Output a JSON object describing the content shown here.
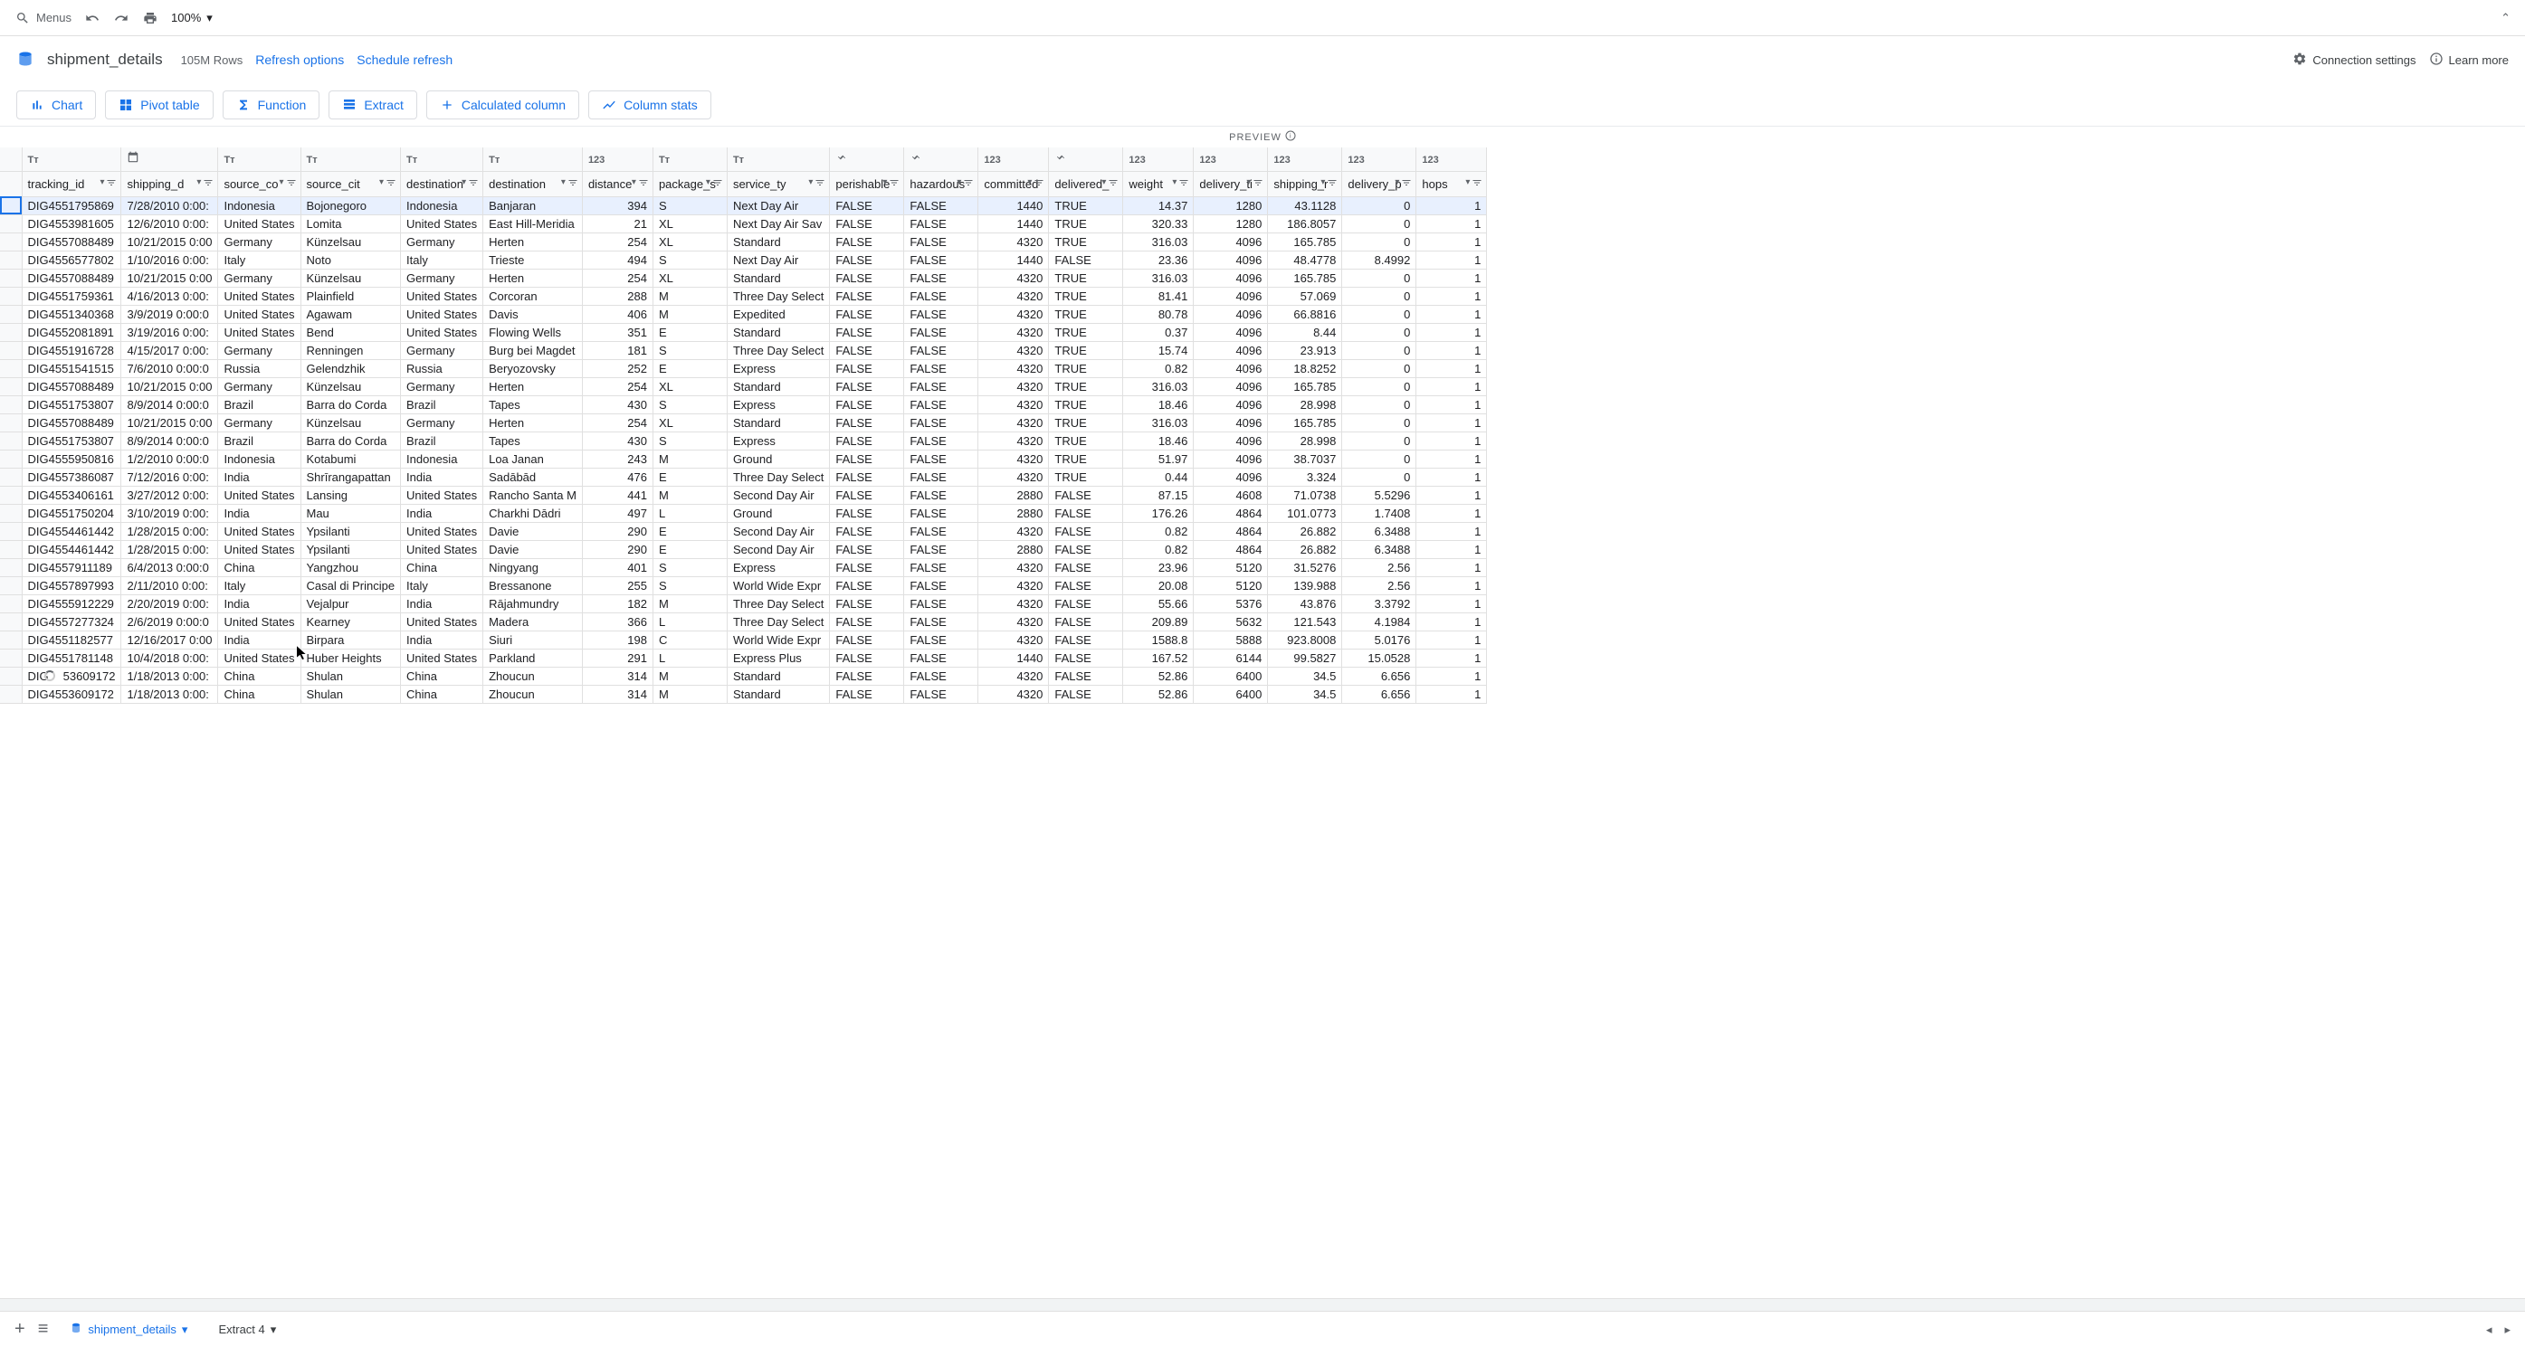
{
  "toolbar": {
    "menus": "Menus",
    "zoom": "100%"
  },
  "header": {
    "table_name": "shipment_details",
    "row_count": "105M Rows",
    "refresh_options": "Refresh options",
    "schedule_refresh": "Schedule refresh",
    "connection_settings": "Connection settings",
    "learn_more": "Learn more"
  },
  "actions": {
    "chart": "Chart",
    "pivot": "Pivot table",
    "function": "Function",
    "extract": "Extract",
    "calc_col": "Calculated column",
    "col_stats": "Column stats"
  },
  "preview": "PREVIEW",
  "columns": [
    {
      "name": "tracking_id",
      "type": "Tт",
      "align": "left",
      "width": 84
    },
    {
      "name": "shipping_d",
      "type": "date",
      "align": "left",
      "width": 80
    },
    {
      "name": "source_co",
      "type": "Tт",
      "align": "left",
      "width": 82
    },
    {
      "name": "source_cit",
      "type": "Tт",
      "align": "left",
      "width": 82
    },
    {
      "name": "destination",
      "type": "Tт",
      "align": "left",
      "width": 82
    },
    {
      "name": "destination",
      "type": "Tт",
      "align": "left",
      "width": 82
    },
    {
      "name": "distance",
      "type": "123",
      "align": "right",
      "width": 78
    },
    {
      "name": "package_s",
      "type": "Tт",
      "align": "left",
      "width": 82
    },
    {
      "name": "service_ty",
      "type": "Tт",
      "align": "left",
      "width": 82
    },
    {
      "name": "perishable",
      "type": "bool",
      "align": "left",
      "width": 82
    },
    {
      "name": "hazardous",
      "type": "bool",
      "align": "left",
      "width": 82
    },
    {
      "name": "committed",
      "type": "123",
      "align": "right",
      "width": 78
    },
    {
      "name": "delivered_",
      "type": "bool",
      "align": "left",
      "width": 82
    },
    {
      "name": "weight",
      "type": "123",
      "align": "right",
      "width": 78
    },
    {
      "name": "delivery_ti",
      "type": "123",
      "align": "right",
      "width": 82
    },
    {
      "name": "shipping_r",
      "type": "123",
      "align": "right",
      "width": 82
    },
    {
      "name": "delivery_p",
      "type": "123",
      "align": "right",
      "width": 82
    },
    {
      "name": "hops",
      "type": "123",
      "align": "right",
      "width": 78
    }
  ],
  "rows": [
    [
      "DIG4551795869",
      "7/28/2010 0:00:",
      "Indonesia",
      "Bojonegoro",
      "Indonesia",
      "Banjaran",
      "394",
      "S",
      "Next Day Air",
      "FALSE",
      "FALSE",
      "1440",
      "TRUE",
      "14.37",
      "1280",
      "43.1128",
      "0",
      "1"
    ],
    [
      "DIG4553981605",
      "12/6/2010 0:00:",
      "United States",
      "Lomita",
      "United States",
      "East Hill-Meridia",
      "21",
      "XL",
      "Next Day Air Sav",
      "FALSE",
      "FALSE",
      "1440",
      "TRUE",
      "320.33",
      "1280",
      "186.8057",
      "0",
      "1"
    ],
    [
      "DIG4557088489",
      "10/21/2015 0:00",
      "Germany",
      "Künzelsau",
      "Germany",
      "Herten",
      "254",
      "XL",
      "Standard",
      "FALSE",
      "FALSE",
      "4320",
      "TRUE",
      "316.03",
      "4096",
      "165.785",
      "0",
      "1"
    ],
    [
      "DIG4556577802",
      "1/10/2016 0:00:",
      "Italy",
      "Noto",
      "Italy",
      "Trieste",
      "494",
      "S",
      "Next Day Air",
      "FALSE",
      "FALSE",
      "1440",
      "FALSE",
      "23.36",
      "4096",
      "48.4778",
      "8.4992",
      "1"
    ],
    [
      "DIG4557088489",
      "10/21/2015 0:00",
      "Germany",
      "Künzelsau",
      "Germany",
      "Herten",
      "254",
      "XL",
      "Standard",
      "FALSE",
      "FALSE",
      "4320",
      "TRUE",
      "316.03",
      "4096",
      "165.785",
      "0",
      "1"
    ],
    [
      "DIG4551759361",
      "4/16/2013 0:00:",
      "United States",
      "Plainfield",
      "United States",
      "Corcoran",
      "288",
      "M",
      "Three Day Select",
      "FALSE",
      "FALSE",
      "4320",
      "TRUE",
      "81.41",
      "4096",
      "57.069",
      "0",
      "1"
    ],
    [
      "DIG4551340368",
      "3/9/2019 0:00:0",
      "United States",
      "Agawam",
      "United States",
      "Davis",
      "406",
      "M",
      "Expedited",
      "FALSE",
      "FALSE",
      "4320",
      "TRUE",
      "80.78",
      "4096",
      "66.8816",
      "0",
      "1"
    ],
    [
      "DIG4552081891",
      "3/19/2016 0:00:",
      "United States",
      "Bend",
      "United States",
      "Flowing Wells",
      "351",
      "E",
      "Standard",
      "FALSE",
      "FALSE",
      "4320",
      "TRUE",
      "0.37",
      "4096",
      "8.44",
      "0",
      "1"
    ],
    [
      "DIG4551916728",
      "4/15/2017 0:00:",
      "Germany",
      "Renningen",
      "Germany",
      "Burg bei Magdet",
      "181",
      "S",
      "Three Day Select",
      "FALSE",
      "FALSE",
      "4320",
      "TRUE",
      "15.74",
      "4096",
      "23.913",
      "0",
      "1"
    ],
    [
      "DIG4551541515",
      "7/6/2010 0:00:0",
      "Russia",
      "Gelendzhik",
      "Russia",
      "Beryozovsky",
      "252",
      "E",
      "Express",
      "FALSE",
      "FALSE",
      "4320",
      "TRUE",
      "0.82",
      "4096",
      "18.8252",
      "0",
      "1"
    ],
    [
      "DIG4557088489",
      "10/21/2015 0:00",
      "Germany",
      "Künzelsau",
      "Germany",
      "Herten",
      "254",
      "XL",
      "Standard",
      "FALSE",
      "FALSE",
      "4320",
      "TRUE",
      "316.03",
      "4096",
      "165.785",
      "0",
      "1"
    ],
    [
      "DIG4551753807",
      "8/9/2014 0:00:0",
      "Brazil",
      "Barra do Corda",
      "Brazil",
      "Tapes",
      "430",
      "S",
      "Express",
      "FALSE",
      "FALSE",
      "4320",
      "TRUE",
      "18.46",
      "4096",
      "28.998",
      "0",
      "1"
    ],
    [
      "DIG4557088489",
      "10/21/2015 0:00",
      "Germany",
      "Künzelsau",
      "Germany",
      "Herten",
      "254",
      "XL",
      "Standard",
      "FALSE",
      "FALSE",
      "4320",
      "TRUE",
      "316.03",
      "4096",
      "165.785",
      "0",
      "1"
    ],
    [
      "DIG4551753807",
      "8/9/2014 0:00:0",
      "Brazil",
      "Barra do Corda",
      "Brazil",
      "Tapes",
      "430",
      "S",
      "Express",
      "FALSE",
      "FALSE",
      "4320",
      "TRUE",
      "18.46",
      "4096",
      "28.998",
      "0",
      "1"
    ],
    [
      "DIG4555950816",
      "1/2/2010 0:00:0",
      "Indonesia",
      "Kotabumi",
      "Indonesia",
      "Loa Janan",
      "243",
      "M",
      "Ground",
      "FALSE",
      "FALSE",
      "4320",
      "TRUE",
      "51.97",
      "4096",
      "38.7037",
      "0",
      "1"
    ],
    [
      "DIG4557386087",
      "7/12/2016 0:00:",
      "India",
      "Shrīrangapattan",
      "India",
      "Sadābād",
      "476",
      "E",
      "Three Day Select",
      "FALSE",
      "FALSE",
      "4320",
      "TRUE",
      "0.44",
      "4096",
      "3.324",
      "0",
      "1"
    ],
    [
      "DIG4553406161",
      "3/27/2012 0:00:",
      "United States",
      "Lansing",
      "United States",
      "Rancho Santa M",
      "441",
      "M",
      "Second Day Air",
      "FALSE",
      "FALSE",
      "2880",
      "FALSE",
      "87.15",
      "4608",
      "71.0738",
      "5.5296",
      "1"
    ],
    [
      "DIG4551750204",
      "3/10/2019 0:00:",
      "India",
      "Mau",
      "India",
      "Charkhi Dādri",
      "497",
      "L",
      "Ground",
      "FALSE",
      "FALSE",
      "2880",
      "FALSE",
      "176.26",
      "4864",
      "101.0773",
      "1.7408",
      "1"
    ],
    [
      "DIG4554461442",
      "1/28/2015 0:00:",
      "United States",
      "Ypsilanti",
      "United States",
      "Davie",
      "290",
      "E",
      "Second Day Air",
      "FALSE",
      "FALSE",
      "4320",
      "FALSE",
      "0.82",
      "4864",
      "26.882",
      "6.3488",
      "1"
    ],
    [
      "DIG4554461442",
      "1/28/2015 0:00:",
      "United States",
      "Ypsilanti",
      "United States",
      "Davie",
      "290",
      "E",
      "Second Day Air",
      "FALSE",
      "FALSE",
      "2880",
      "FALSE",
      "0.82",
      "4864",
      "26.882",
      "6.3488",
      "1"
    ],
    [
      "DIG4557911189",
      "6/4/2013 0:00:0",
      "China",
      "Yangzhou",
      "China",
      "Ningyang",
      "401",
      "S",
      "Express",
      "FALSE",
      "FALSE",
      "4320",
      "FALSE",
      "23.96",
      "5120",
      "31.5276",
      "2.56",
      "1"
    ],
    [
      "DIG4557897993",
      "2/11/2010 0:00:",
      "Italy",
      "Casal di Principe",
      "Italy",
      "Bressanone",
      "255",
      "S",
      "World Wide Expr",
      "FALSE",
      "FALSE",
      "4320",
      "FALSE",
      "20.08",
      "5120",
      "139.988",
      "2.56",
      "1"
    ],
    [
      "DIG4555912229",
      "2/20/2019 0:00:",
      "India",
      "Vejalpur",
      "India",
      "Rājahmundry",
      "182",
      "M",
      "Three Day Select",
      "FALSE",
      "FALSE",
      "4320",
      "FALSE",
      "55.66",
      "5376",
      "43.876",
      "3.3792",
      "1"
    ],
    [
      "DIG4557277324",
      "2/6/2019 0:00:0",
      "United States",
      "Kearney",
      "United States",
      "Madera",
      "366",
      "L",
      "Three Day Select",
      "FALSE",
      "FALSE",
      "4320",
      "FALSE",
      "209.89",
      "5632",
      "121.543",
      "4.1984",
      "1"
    ],
    [
      "DIG4551182577",
      "12/16/2017 0:00",
      "India",
      "Birpara",
      "India",
      "Siuri",
      "198",
      "C",
      "World Wide Expr",
      "FALSE",
      "FALSE",
      "4320",
      "FALSE",
      "1588.8",
      "5888",
      "923.8008",
      "5.0176",
      "1"
    ],
    [
      "DIG4551781148",
      "10/4/2018 0:00:",
      "United States",
      "Huber Heights",
      "United States",
      "Parkland",
      "291",
      "L",
      "Express Plus",
      "FALSE",
      "FALSE",
      "1440",
      "FALSE",
      "167.52",
      "6144",
      "99.5827",
      "15.0528",
      "1"
    ],
    [
      "DIG    53609172",
      "1/18/2013 0:00:",
      "China",
      "Shulan",
      "China",
      "Zhoucun",
      "314",
      "M",
      "Standard",
      "FALSE",
      "FALSE",
      "4320",
      "FALSE",
      "52.86",
      "6400",
      "34.5",
      "6.656",
      "1"
    ],
    [
      "DIG4553609172",
      "1/18/2013 0:00:",
      "China",
      "Shulan",
      "China",
      "Zhoucun",
      "314",
      "M",
      "Standard",
      "FALSE",
      "FALSE",
      "4320",
      "FALSE",
      "52.86",
      "6400",
      "34.5",
      "6.656",
      "1"
    ]
  ],
  "sheets": {
    "main": "shipment_details",
    "extract": "Extract 4"
  }
}
